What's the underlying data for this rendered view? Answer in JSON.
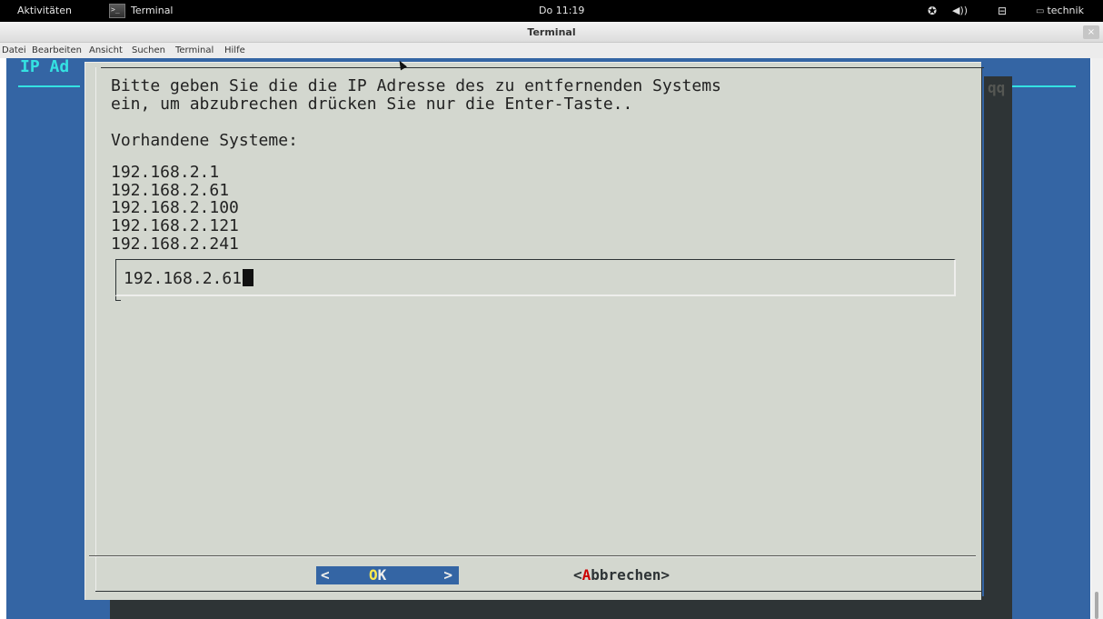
{
  "topbar": {
    "activities": "Aktivitäten",
    "app_name": "Terminal",
    "clock": "Do 11:19",
    "user": "technik",
    "icons": [
      "accessibility-icon",
      "volume-icon",
      "network-icon",
      "user-icon"
    ]
  },
  "window": {
    "title": "Terminal",
    "close": "×"
  },
  "menubar": {
    "items": [
      "Datei",
      "Bearbeiten",
      "Ansicht",
      "Suchen",
      "Terminal",
      "Hilfe"
    ]
  },
  "terminal": {
    "background_title": "IP Ad",
    "background_title_tail": "qq"
  },
  "dialog": {
    "prompt_line1": "Bitte geben Sie die die IP Adresse des zu entfernenden Systems",
    "prompt_line2": "ein, um abzubrechen drücken Sie nur die Enter-Taste..",
    "systems_heading": "Vorhandene Systeme:",
    "systems": [
      "192.168.2.1",
      "192.168.2.61",
      "192.168.2.100",
      "192.168.2.121",
      "192.168.2.241"
    ],
    "input_value": "192.168.2.61",
    "ok": {
      "left": "<",
      "hotkey": "O",
      "rest": "K",
      "right": ">"
    },
    "cancel": {
      "open": "<",
      "hotkey": "A",
      "rest": "bbrechen",
      "close": ">"
    }
  },
  "colors": {
    "terminal_bg": "#3465a4",
    "dialog_bg": "#d3d7cf",
    "title_cyan": "#34e2e2",
    "hotkey_yellow": "#fce94f",
    "hotkey_red": "#cc0000"
  }
}
